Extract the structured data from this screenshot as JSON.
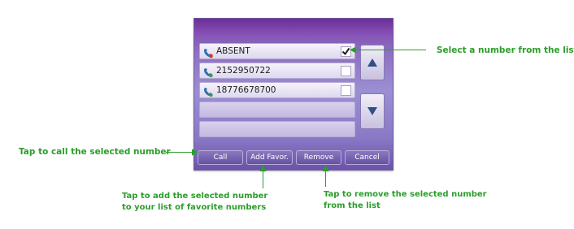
{
  "dialog": {
    "numbers": [
      {
        "label": "ABSENT",
        "checked": true
      },
      {
        "label": "2152950722",
        "checked": false
      },
      {
        "label": "18776678700",
        "checked": false
      },
      {
        "label": "",
        "checked": null
      },
      {
        "label": "",
        "checked": null
      }
    ],
    "buttons": {
      "call": "Call",
      "add_favor": "Add Favor.",
      "remove": "Remove",
      "cancel": "Cancel"
    },
    "icons": {
      "phone": "phone-icon",
      "check": "check-icon",
      "up": "up-arrow-icon",
      "down": "down-arrow-icon"
    }
  },
  "annotations": {
    "select": "Select a number from the list",
    "call": "Tap to call the selected number",
    "add_line1": "Tap to add the selected number",
    "add_line2": "to your list of favorite numbers",
    "remove_line1": "Tap to remove the selected number",
    "remove_line2": "from the list"
  },
  "colors": {
    "annotation": "#2a9e2a",
    "panel_top": "#7a3fa6",
    "panel_bottom": "#6a54aa"
  }
}
